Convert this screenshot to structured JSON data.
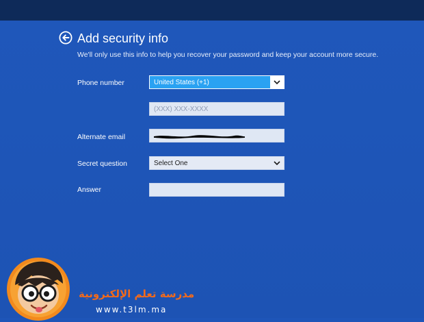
{
  "page": {
    "title": "Add security info",
    "subtitle": "We'll only use this info to help you recover your password and keep your account more secure.",
    "back_icon": "back-arrow-circle-icon"
  },
  "form": {
    "phone_label": "Phone number",
    "phone_country_value": "United States (+1)",
    "phone_number_placeholder": "(XXX) XXX-XXXX",
    "alternate_email_label": "Alternate email",
    "secret_question_label": "Secret question",
    "secret_question_value": "Select One",
    "answer_label": "Answer"
  },
  "watermark": {
    "arabic_text": "مدرسة تعلم الإلكترونية",
    "url": "www.t3lm.ma"
  },
  "colors": {
    "background": "#1e55b8",
    "top_bar": "#0e2a59",
    "field": "#dfe7f4",
    "selected_dropdown": "#2aa2f2",
    "brand_orange": "#f26a1b"
  }
}
